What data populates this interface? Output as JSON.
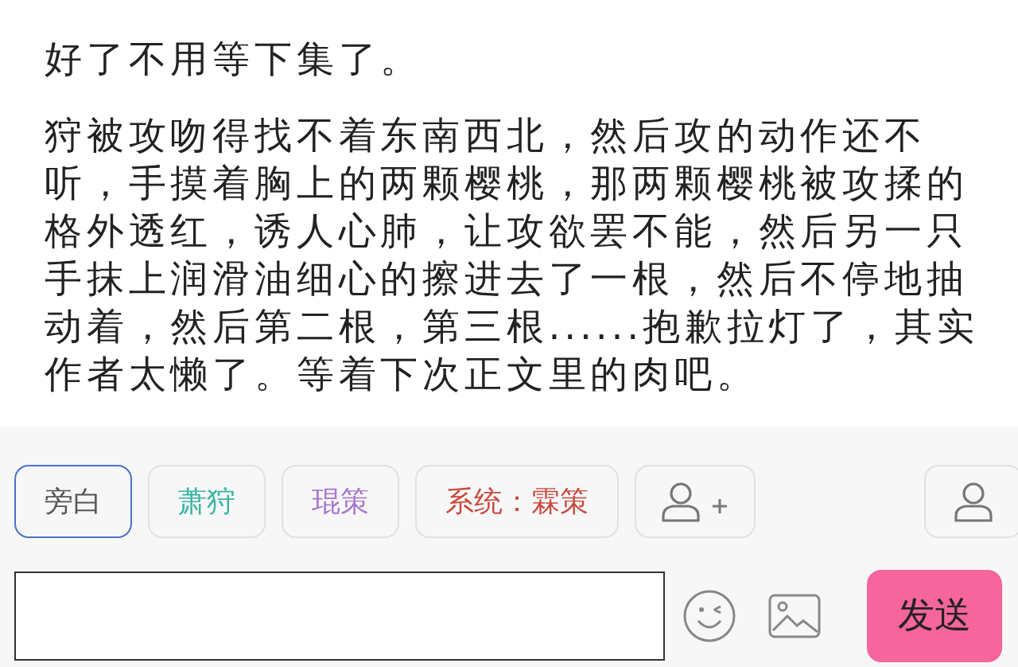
{
  "messages": [
    {
      "text": "好了不用等下集了。"
    },
    {
      "text": "狩被攻吻得找不着东南西北，然后攻的动作还不听，手摸着胸上的两颗樱桃，那两颗樱桃被攻揉的格外透红，诱人心肺，让攻欲罢不能，然后另一只手抹上润滑油细心的擦进去了一根，然后不停地抽动着，然后第二根，第三根......抱歉拉灯了，其实作者太懒了。等着下次正文里的肉吧。"
    }
  ],
  "roles": [
    {
      "label": "旁白",
      "selected": true,
      "color": "#555555"
    },
    {
      "label": "萧狩",
      "selected": false,
      "color": "#3ab5a2"
    },
    {
      "label": "琨策",
      "selected": false,
      "color": "#a774cf"
    },
    {
      "label": "系统：霖策",
      "selected": false,
      "color": "#c94a3e"
    }
  ],
  "send_button": "发送"
}
